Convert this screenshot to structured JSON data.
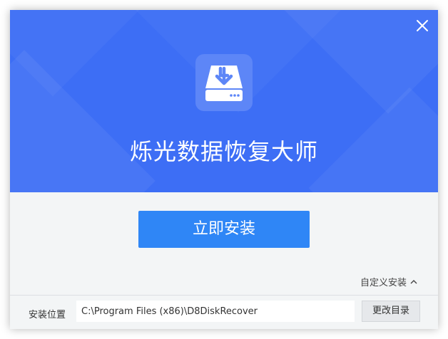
{
  "app": {
    "title": "烁光数据恢复大师",
    "icon": "hard-drive-download-icon"
  },
  "window": {
    "close_icon": "close-icon"
  },
  "actions": {
    "install_label": "立即安装",
    "custom_install_label": "自定义安装",
    "custom_install_icon": "chevron-up-icon"
  },
  "install_location": {
    "label": "安装位置",
    "path": "C:\\Program Files (x86)\\D8DiskRecover",
    "change_button_label": "更改目录"
  },
  "colors": {
    "hero_background": "#3d6ef5",
    "install_button": "#2f86f6",
    "footer_background": "#f3f5f6"
  }
}
